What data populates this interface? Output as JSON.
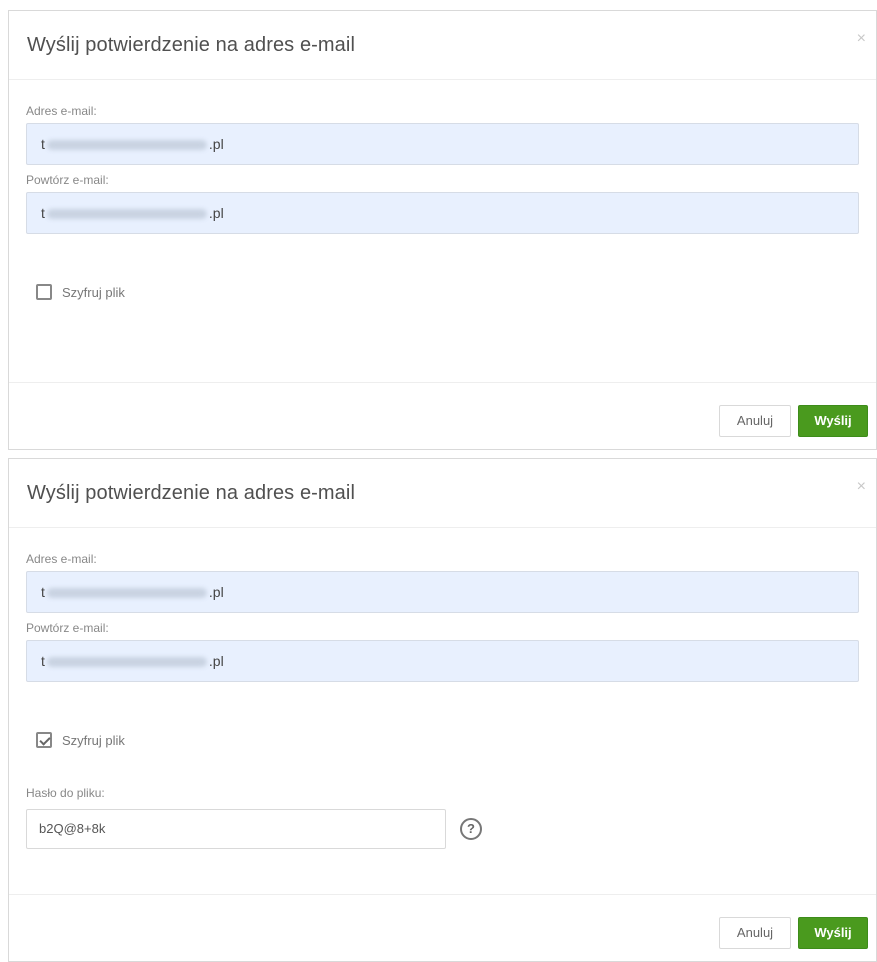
{
  "dialogs": [
    {
      "title": "Wyślij potwierdzenie na adres e-mail",
      "close_glyph": "×",
      "email_label": "Adres e-mail:",
      "email_value_start": "t",
      "email_value_end": ".pl",
      "repeat_label": "Powtórz e-mail:",
      "repeat_value_start": "t",
      "repeat_value_end": ".pl",
      "encrypt_label": "Szyfruj plik",
      "encrypt_checked": false,
      "cancel_label": "Anuluj",
      "send_label": "Wyślij"
    },
    {
      "title": "Wyślij potwierdzenie na adres e-mail",
      "close_glyph": "×",
      "email_label": "Adres e-mail:",
      "email_value_start": "t",
      "email_value_end": ".pl",
      "repeat_label": "Powtórz e-mail:",
      "repeat_value_start": "t",
      "repeat_value_end": ".pl",
      "encrypt_label": "Szyfruj plik",
      "encrypt_checked": true,
      "password_label": "Hasło do pliku:",
      "password_value": "b2Q@8+8k",
      "help_glyph": "?",
      "cancel_label": "Anuluj",
      "send_label": "Wyślij"
    }
  ],
  "colors": {
    "send_button": "#4a9a1e",
    "input_autofill_bg": "#e8f0fe"
  },
  "icons": {
    "close": "close-icon",
    "help": "help-circle-icon",
    "checkbox": "checkbox-icon"
  }
}
